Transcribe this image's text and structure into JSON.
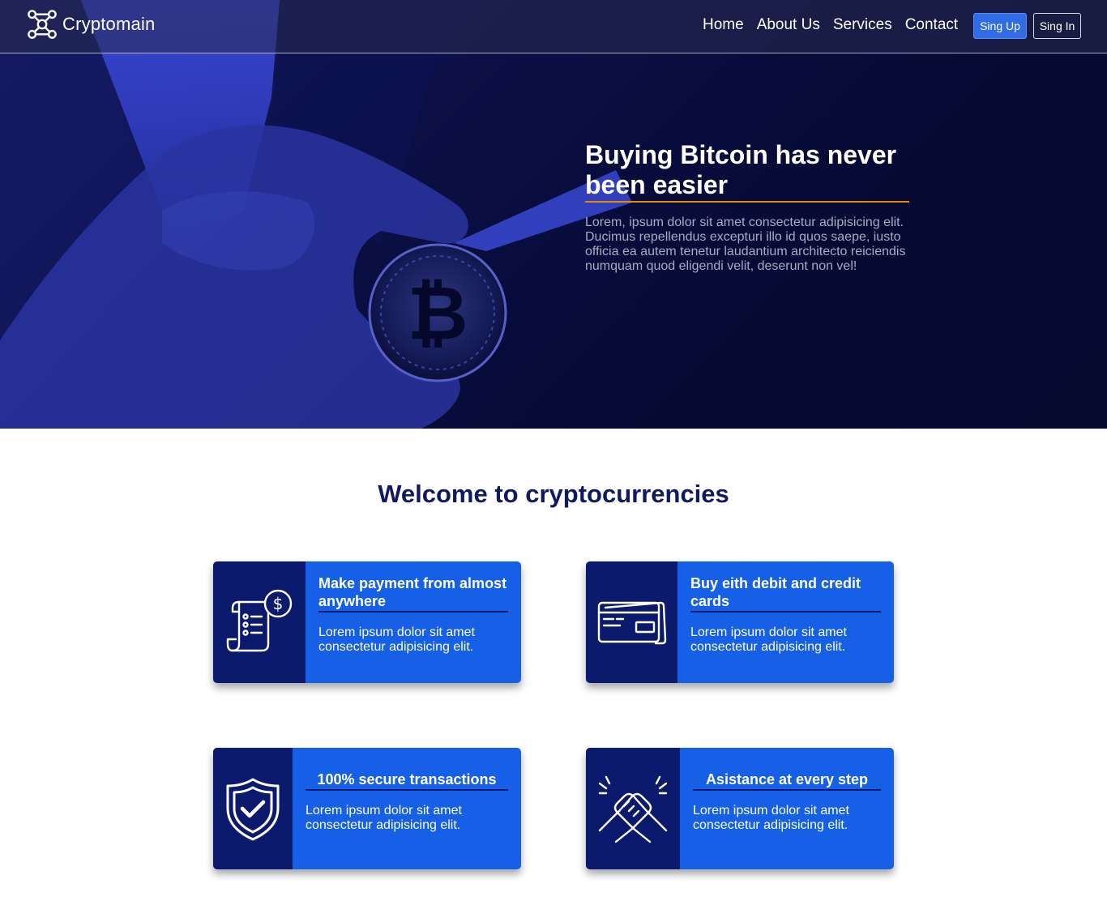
{
  "brand": {
    "name": "Cryptomain",
    "logo_icon": "molecule-logo-icon"
  },
  "nav": {
    "links": [
      "Home",
      "About Us",
      "Services",
      "Contact"
    ],
    "signup_label": "Sing Up",
    "signin_label": "Sing In"
  },
  "hero": {
    "title": "Buying Bitcoin has never been easier",
    "description": "Lorem, ipsum dolor sit amet consectetur adipisicing elit. Ducimus repellendus excepturi illo id quos saepe, iusto officia ea autem tenetur laudantium architecto reiciendis numquam quod eligendi velit, deserunt non vel!"
  },
  "welcome": {
    "title": "Welcome to cryptocurrencies"
  },
  "features": [
    {
      "icon": "invoice-dollar-icon",
      "title": "Make payment from almost anywhere",
      "text": "Lorem ipsum dolor sit amet consectetur adipisicing elit."
    },
    {
      "icon": "credit-card-icon",
      "title": "Buy eith debit and credit cards",
      "text": "Lorem ipsum dolor sit amet consectetur adipisicing elit."
    },
    {
      "icon": "shield-check-icon",
      "title": "100% secure transactions",
      "text": "Lorem ipsum dolor sit amet consectetur adipisicing elit."
    },
    {
      "icon": "handshake-icon",
      "title": "Asistance at every step",
      "text": "Lorem ipsum dolor sit amet consectetur adipisicing elit."
    }
  ],
  "colors": {
    "accent_orange": "#e38a0e",
    "primary_blue": "#1560e6",
    "navy": "#0c1a6e",
    "heading_navy": "#0f1a63"
  }
}
